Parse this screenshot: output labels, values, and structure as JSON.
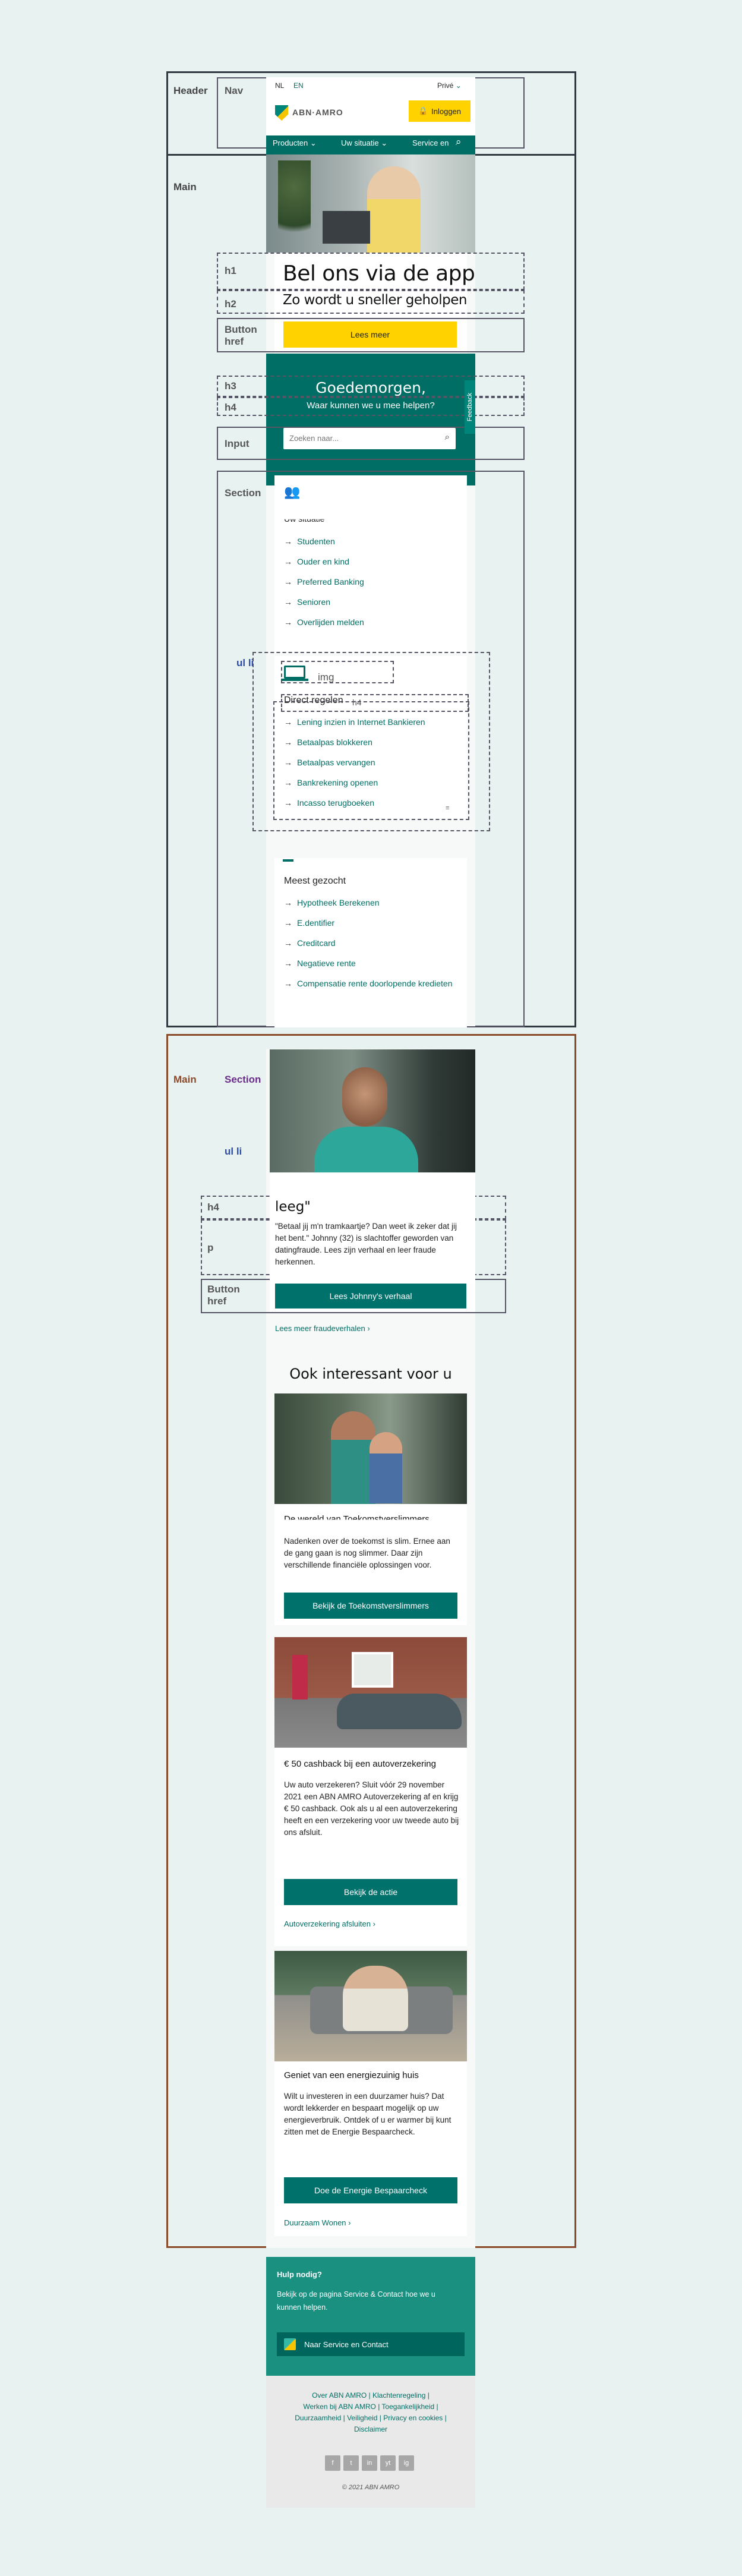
{
  "annotations": {
    "header": "Header",
    "nav": "Nav",
    "main": "Main",
    "h1": "h1",
    "h2": "h2",
    "button_href": "Button\nhref",
    "h3": "h3",
    "h4": "h4",
    "input": "Input",
    "section": "Section",
    "ul_li": "ul li",
    "img": "img",
    "h4b": "h4",
    "main2": "Main",
    "section2": "Section",
    "ul_li2": "ul li",
    "h4c": "h4",
    "p": "p",
    "button_href2": "Button\nhref"
  },
  "header": {
    "lang_nl": "NL",
    "lang_en": "EN",
    "segment": "Privé",
    "logo_text": "ABN·AMRO",
    "login_label": "Inloggen",
    "nav": [
      "Producten",
      "Uw situatie",
      "Service en"
    ]
  },
  "hero": {
    "title": "Bel ons via de app",
    "subtitle": "Zo wordt u sneller geholpen",
    "cta": "Lees meer"
  },
  "greeting": {
    "title": "Goedemorgen,",
    "subtitle": "Waar kunnen we u mee helpen?",
    "search_placeholder": "Zoeken naar...",
    "feedback": "Feedback"
  },
  "situatie": {
    "heading": "Uw situatie",
    "items": [
      "Studenten",
      "Ouder en kind",
      "Preferred Banking",
      "Senioren",
      "Overlijden melden"
    ]
  },
  "direct": {
    "heading": "Direct regelen",
    "items": [
      "Lening inzien in Internet Bankieren",
      "Betaalpas blokkeren",
      "Betaalpas vervangen",
      "Bankrekening openen",
      "Incasso terugboeken"
    ]
  },
  "meest": {
    "heading": "Meest gezocht",
    "items": [
      "Hypotheek Berekenen",
      "E.dentifier",
      "Creditcard",
      "Negatieve rente",
      "Compensatie rente doorlopende kredieten"
    ]
  },
  "story": {
    "heading": "leeg\"",
    "text": "\"Betaal jij m'n tramkaartje? Dan weet ik zeker dat jij het bent.\" Johnny (32) is slachtoffer geworden van datingfraude. Lees zijn verhaal en leer fraude herkennen.",
    "cta": "Lees Johnny's verhaal",
    "link": "Lees meer fraudeverhalen"
  },
  "interest": {
    "heading": "Ook interessant voor u",
    "cards": [
      {
        "title": "De wereld van Toekomstverslimmers",
        "text": "Nadenken over de toekomst is slim. Ernee aan de gang gaan is nog slimmer. Daar zijn verschillende financiële oplossingen voor.",
        "cta": "Bekijk de Toekomstverslimmers",
        "link": ""
      },
      {
        "title": "€ 50 cashback bij een autoverzekering",
        "text": "Uw auto verzekeren? Sluit vóór 29 november 2021 een ABN AMRO Autoverzekering af en krijg € 50 cashback. Ook als u al een autoverzekering heeft en een verzekering voor uw tweede auto bij ons afsluit.",
        "cta": "Bekijk de actie",
        "link": "Autoverzekering afsluiten"
      },
      {
        "title": "Geniet van een energiezuinig huis",
        "text": "Wilt u investeren in een duurzamer huis? Dat wordt lekkerder en bespaart mogelijk op uw energieverbruik. Ontdek of u er warmer bij kunt zitten met de Energie Bespaarcheck.",
        "cta": "Doe de Energie Bespaarcheck",
        "link": "Duurzaam Wonen"
      }
    ]
  },
  "help": {
    "heading": "Hulp nodig?",
    "text": "Bekijk op de pagina Service & Contact hoe we u kunnen helpen.",
    "cta": "Naar Service en Contact"
  },
  "footer": {
    "links_line1": "Over ABN AMRO  |  Klachtenregeling  |",
    "links_line2": "Werken bij ABN AMRO  |  Toegankelijkheid  |",
    "links_line3": "Duurzaamheid  |  Veiligheid  |  Privacy en cookies  |",
    "links_line4": "Disclaimer",
    "social": [
      "f",
      "t",
      "in",
      "yt",
      "ig"
    ],
    "copyright": "© 2021 ABN AMRO"
  },
  "colors": {
    "teal": "#006e64",
    "yellow": "#ffd200",
    "frame": "#2e3a3f",
    "brown": "#8b4a2a"
  }
}
